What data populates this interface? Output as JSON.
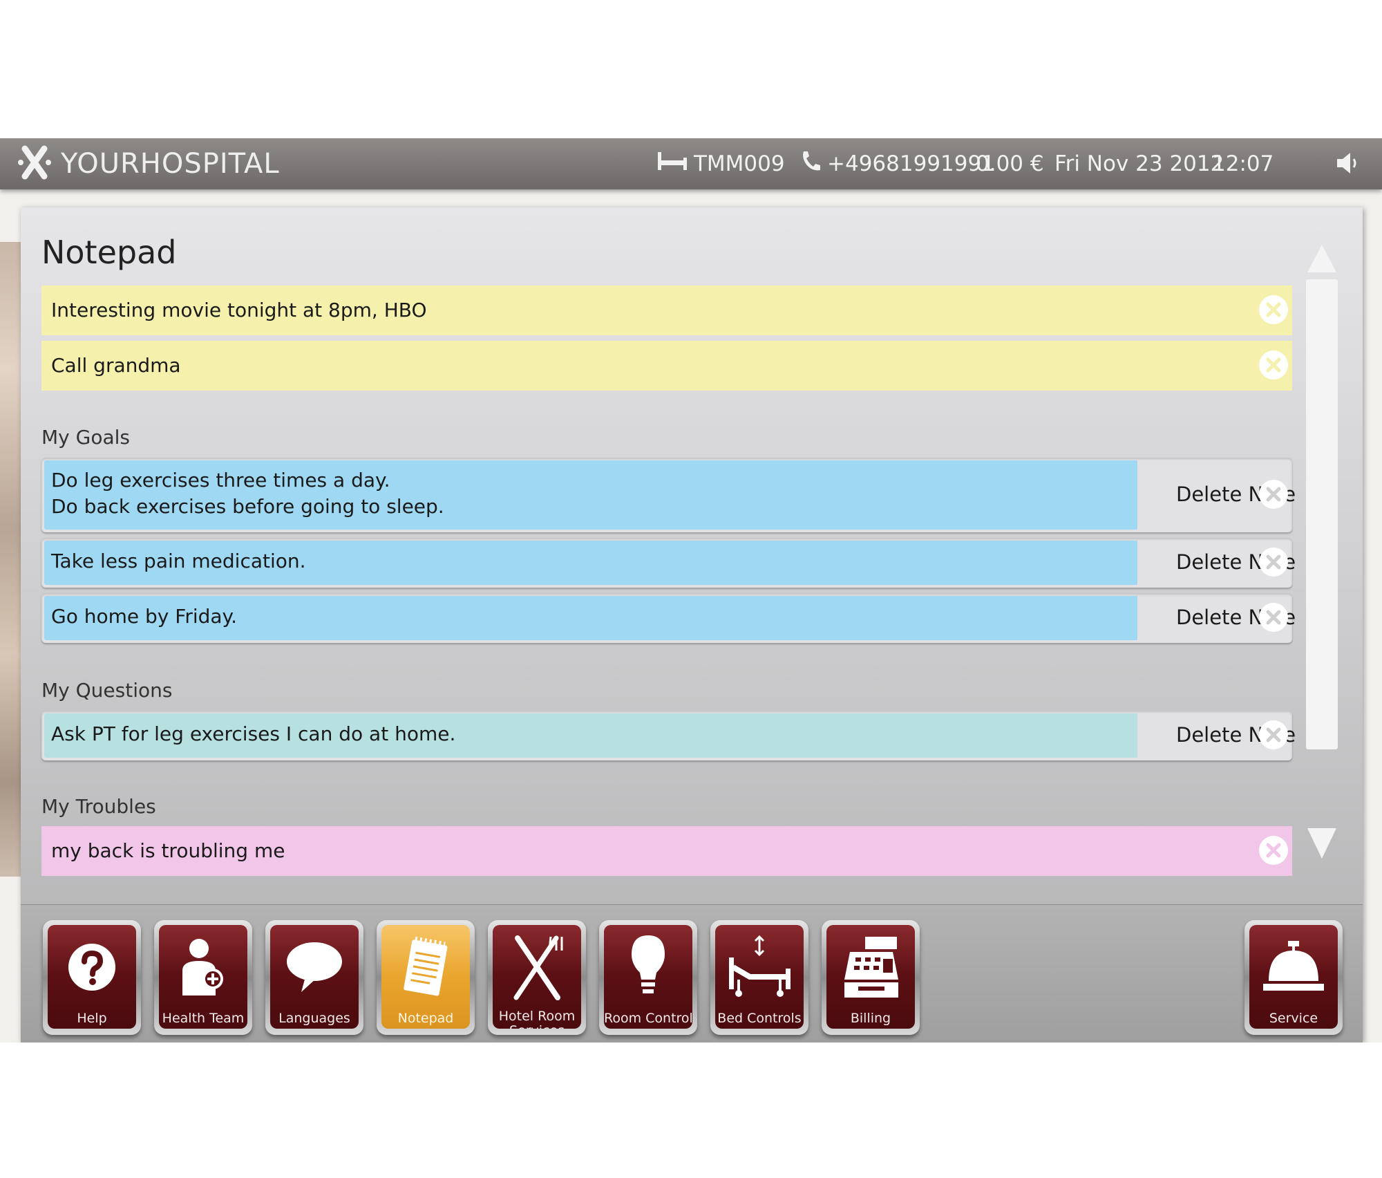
{
  "header": {
    "brand": "YOURHOSPITAL",
    "bed_id": "TMM009",
    "phone": "+49681991991",
    "balance": "0.00 €",
    "date": "Fri Nov 23 2012",
    "time": "12:07",
    "icons": [
      "x-logo-icon",
      "bed-icon",
      "phone-icon",
      "speaker-icon"
    ]
  },
  "notepad": {
    "title": "Notepad",
    "quick_notes": [
      {
        "text": "Interesting movie tonight at 8pm, HBO"
      },
      {
        "text": "Call grandma"
      }
    ],
    "sections": {
      "goals": {
        "label": "My Goals",
        "items": [
          {
            "lines": [
              "Do leg exercises three times a day.",
              "Do back exercises before going to sleep."
            ],
            "action": "Delete Note"
          },
          {
            "lines": [
              "Take less pain medication."
            ],
            "action": "Delete Note"
          },
          {
            "lines": [
              "Go home by Friday."
            ],
            "action": "Delete Note"
          }
        ]
      },
      "questions": {
        "label": "My Questions",
        "items": [
          {
            "lines": [
              "Ask PT for leg exercises I can do at home."
            ],
            "action": "Delete Note"
          }
        ]
      },
      "troubles": {
        "label": "My Troubles",
        "items": [
          {
            "lines": [
              "my back is troubling me"
            ]
          }
        ]
      }
    }
  },
  "dock": {
    "items": [
      {
        "label": "Help",
        "icon": "help-icon"
      },
      {
        "label": "Health Team",
        "icon": "health-team-icon"
      },
      {
        "label": "Languages",
        "icon": "speech-bubble-icon"
      },
      {
        "label": "Notepad",
        "icon": "notepad-icon",
        "active": true
      },
      {
        "label": "Hotel Room Services",
        "icon": "cutlery-icon"
      },
      {
        "label": "Room Controls",
        "icon": "lightbulb-icon"
      },
      {
        "label": "Bed Controls",
        "icon": "adjustable-bed-icon"
      },
      {
        "label": "Billing",
        "icon": "cash-register-icon"
      },
      {
        "label": "Service",
        "icon": "service-bell-icon"
      }
    ]
  },
  "colors": {
    "note_yellow": "#f5f0ab",
    "goal_blue": "#9ed8f3",
    "question_teal": "#b7e1e1",
    "trouble_pink": "#f1c6e8",
    "tile_maroon": "#5c1014",
    "tile_active": "#e9a52e"
  }
}
